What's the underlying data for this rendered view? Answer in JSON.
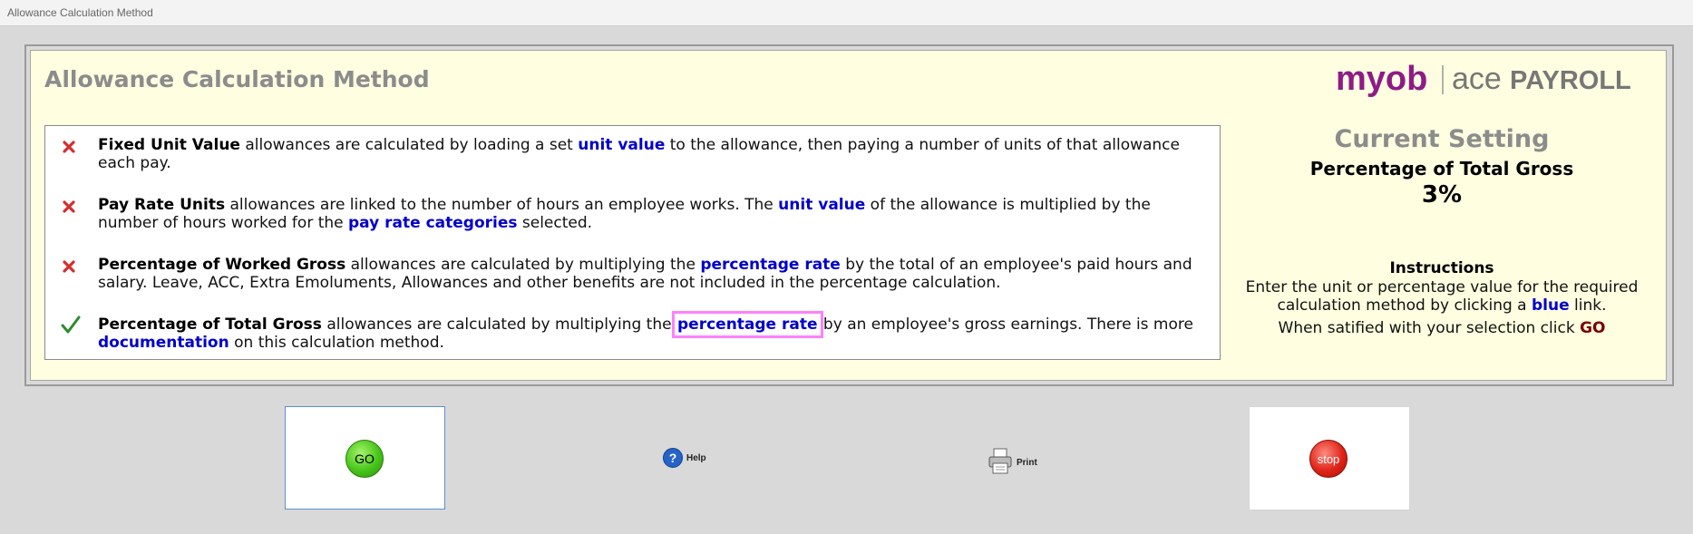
{
  "window": {
    "title": "Allowance Calculation Method"
  },
  "header": {
    "title": "Allowance Calculation Method",
    "logo_text": "myob | ace PAYROLL"
  },
  "options": [
    {
      "status": "not-selected",
      "name": "Fixed Unit Value",
      "text_1": " allowances are calculated by loading a set ",
      "link_1": "unit value",
      "text_2": " to the allowance, then paying a number of units of that allowance each pay."
    },
    {
      "status": "not-selected",
      "name": "Pay Rate Units",
      "text_1": " allowances are linked to the number of hours an employee works. The ",
      "link_1": "unit value",
      "text_2": " of the allowance is multiplied by the number of hours worked for the ",
      "link_2": "pay rate categories",
      "text_3": " selected."
    },
    {
      "status": "not-selected",
      "name": "Percentage of Worked Gross",
      "text_1": " allowances are calculated by multiplying the ",
      "link_1": "percentage rate",
      "text_2": " by the total of an employee's paid hours and salary. Leave, ACC, Extra Emoluments, Allowances and other benefits are not included in the percentage calculation."
    },
    {
      "status": "selected",
      "name": "Percentage of Total Gross",
      "text_1": " allowances are calculated by multiplying the ",
      "link_1": "percentage rate",
      "text_2": " by an employee's gross earnings. There is more ",
      "link_2": "documentation",
      "text_3": " on this calculation method."
    }
  ],
  "current_setting": {
    "title": "Current Setting",
    "method": "Percentage of Total Gross",
    "value": "3%"
  },
  "instructions": {
    "title": "Instructions",
    "text_1": "Enter the unit or percentage value for the required calculation method by clicking a ",
    "link": "blue",
    "text_2": " link.",
    "go_text": "When satified with your selection click ",
    "go_word": "GO"
  },
  "buttons": {
    "go": "GO",
    "help": "Help",
    "print": "Print",
    "stop": "stop"
  },
  "colors": {
    "panel_bg": "#fffee0",
    "link": "#0000cc",
    "x_mark": "#d32f2f",
    "check_mark": "#2e8b2e",
    "highlight": "#ff80ff"
  }
}
